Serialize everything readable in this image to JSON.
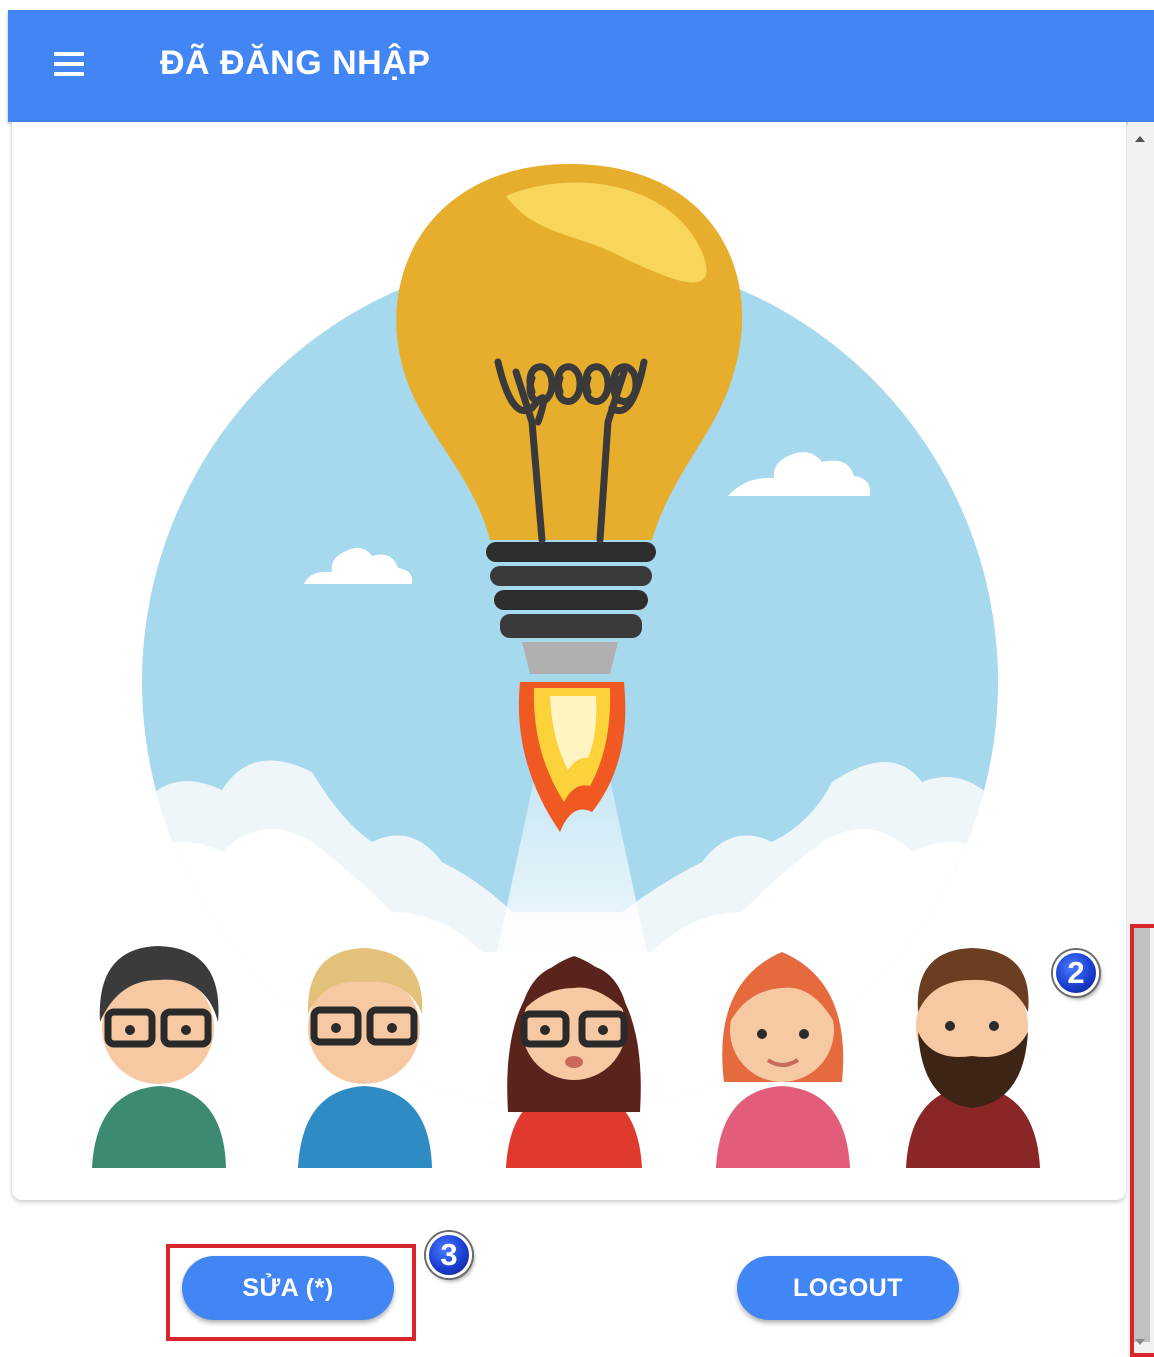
{
  "appbar": {
    "title": "ĐÃ ĐĂNG NHẬP",
    "background": "#4285f4",
    "menu_icon": "hamburger-menu-icon"
  },
  "hero": {
    "illustration": "lightbulb-rocket-with-team-avatars",
    "sky_color": "#a6d8ee"
  },
  "actions": {
    "edit_label": "SỬA (*)",
    "logout_label": "LOGOUT"
  },
  "annotations": {
    "marker_2": "2",
    "marker_3": "3",
    "highlight_color": "#d9262b"
  }
}
